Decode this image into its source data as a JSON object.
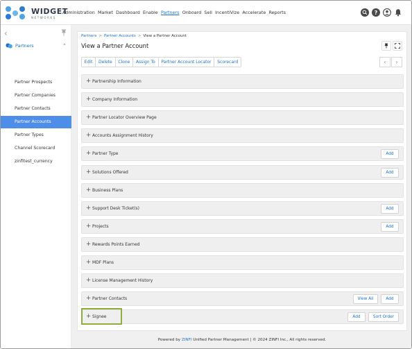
{
  "brand": {
    "name": "WIDGET",
    "tagline": "NETWORKS"
  },
  "nav": [
    "Administration",
    "Market",
    "Dashboard",
    "Enable",
    "Partners",
    "Onboard",
    "Sell",
    "IncentiVize",
    "Accelerate",
    "Reports"
  ],
  "nav_active": "Partners",
  "top_icons": [
    "search-icon",
    "help-icon",
    "user-icon",
    "bell-icon"
  ],
  "sidebar": {
    "back_icon": "chevron-left-icon",
    "pin_icon": "pin-icon",
    "section": "Partners",
    "items": [
      {
        "label": "Partner Prospects"
      },
      {
        "label": "Partner Companies"
      },
      {
        "label": "Partner Contacts"
      },
      {
        "label": "Partner Accounts",
        "active": true
      },
      {
        "label": "Partner Types"
      },
      {
        "label": "Channel Scorecard"
      },
      {
        "label": "zinfitest_currency"
      }
    ]
  },
  "breadcrumb": [
    "Partners",
    "Partner Accounts",
    "View a Partner Account"
  ],
  "page_title": "View a Partner Account",
  "actions": [
    "Edit",
    "Delete",
    "Clone",
    "Assign To",
    "Partner Account Locator",
    "Scorecard"
  ],
  "panels": [
    {
      "title": "Partnership Information",
      "buttons": []
    },
    {
      "title": "Company Information",
      "buttons": []
    },
    {
      "title": "Partner Locator Overview Page",
      "buttons": []
    },
    {
      "title": "Accounts Assignment History",
      "buttons": []
    },
    {
      "title": "Partner Type",
      "buttons": [
        "Add"
      ]
    },
    {
      "title": "Solutions Offered",
      "buttons": [
        "Add"
      ]
    },
    {
      "title": "Business Plans",
      "buttons": []
    },
    {
      "title": "Support Desk Ticket(s)",
      "buttons": [
        "Add"
      ]
    },
    {
      "title": "Projects",
      "buttons": [
        "Add"
      ]
    },
    {
      "title": "Rewards Points Earned",
      "buttons": []
    },
    {
      "title": "MDF Plans",
      "buttons": []
    },
    {
      "title": "License Management History",
      "buttons": []
    },
    {
      "title": "Partner Contacts",
      "buttons": [
        "View All",
        "Add"
      ]
    },
    {
      "title": "Signee",
      "buttons": [
        "Add",
        "Sort Order"
      ]
    }
  ],
  "footer": {
    "prefix": "Powered by",
    "brand": "ZINFI",
    "suffix": "Unified Partner Management | © 2024 ZINFI Inc., All rights reserved."
  },
  "colors": {
    "accent": "#1a73c9",
    "active_item": "#4f8ee8",
    "highlight": "#8fad3c"
  }
}
